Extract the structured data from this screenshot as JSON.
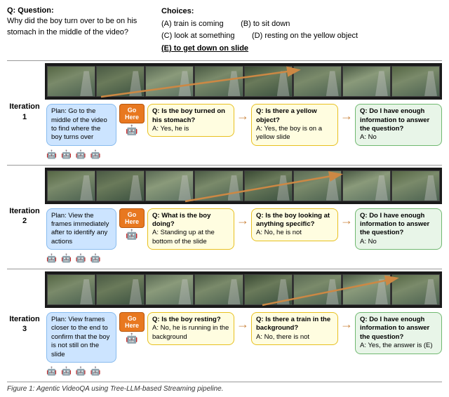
{
  "header": {
    "question_label": "Q: Question:",
    "question_text": "Why did the boy turn over to be on his stomach in the middle of the video?",
    "choices_label": "Choices:",
    "choice_a": "(A) train is coming",
    "choice_b": "(B) to sit down",
    "choice_c": "(C) look at something",
    "choice_d": "(D) resting on the yellow object",
    "choice_e": "(E) to get down on slide"
  },
  "iterations": [
    {
      "label": "Iteration 1",
      "plan": "Plan: Go to the middle of the video to find where the boy turns over",
      "go_here": "Go Here",
      "qa1_q": "Q: Is the boy turned on his stomach?",
      "qa1_a": "A: Yes, he is",
      "qa2_q": "Q: Is there a yellow object?",
      "qa2_a": "A: Yes, the boy is on a yellow slide",
      "qa3_q": "Q: Do I have enough information to answer the question?",
      "qa3_a": "A: No"
    },
    {
      "label": "Iteration 2",
      "plan": "Plan: View the frames immediately after to identify any actions",
      "go_here": "Go Here",
      "qa1_q": "Q: What is the boy doing?",
      "qa1_a": "A: Standing up at the bottom of the slide",
      "qa2_q": "Q: Is the boy looking at anything specific?",
      "qa2_a": "A: No, he is not",
      "qa3_q": "Q: Do I have enough information to answer the question?",
      "qa3_a": "A: No"
    },
    {
      "label": "Iteration 3",
      "plan": "Plan: View frames closer to the end to confirm that the boy is not still on the slide",
      "go_here": "Go Here",
      "qa1_q": "Q: Is the boy resting?",
      "qa1_a": "A: No, he is running in the background",
      "qa2_q": "Q: Is there a train in the background?",
      "qa2_a": "A: No, there is not",
      "qa3_q": "Q: Do I have enough information to answer the question?",
      "qa3_a": "A: Yes, the answer is (E)"
    }
  ],
  "caption": "Figure 1: Agentic VideoQA using Tree-LLM-based Streaming pipeline."
}
